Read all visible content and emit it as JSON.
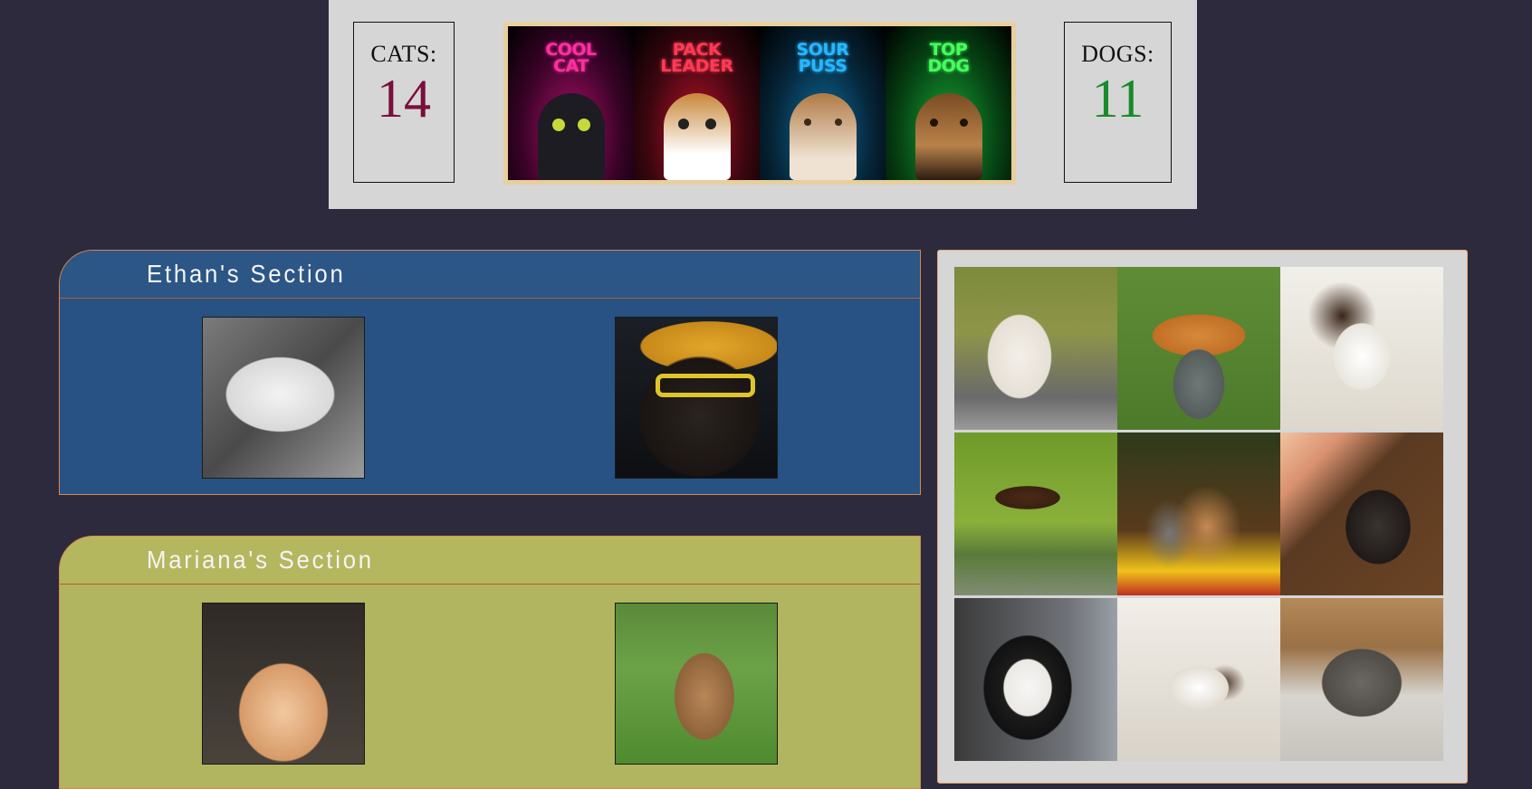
{
  "counters": {
    "cats": {
      "label": "CATS:",
      "value": "14",
      "color": "#7a0f3c"
    },
    "dogs": {
      "label": "DOGS:",
      "value": "11",
      "color": "#1a8a2a"
    }
  },
  "banner": {
    "posters": [
      {
        "title": "COOL\nCAT"
      },
      {
        "title": "PACK\nLEADER"
      },
      {
        "title": "SOUR\nPUSS"
      },
      {
        "title": "TOP\nDOG"
      }
    ]
  },
  "sections": [
    {
      "title": "Ethan's Section",
      "color": "#275283"
    },
    {
      "title": "Mariana's Section",
      "color": "#b2b55f"
    }
  ]
}
